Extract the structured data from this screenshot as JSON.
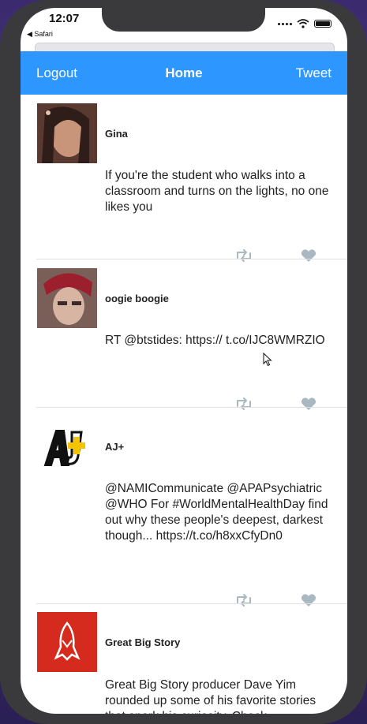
{
  "status_bar": {
    "time": "12:07",
    "back_label": "◀ Safari"
  },
  "nav": {
    "left_label": "Logout",
    "title": "Home",
    "right_label": "Tweet"
  },
  "tweets": [
    {
      "author": "Gina",
      "text": "If you're the student who walks into a classroom and turns on the lights, no one likes you"
    },
    {
      "author": "oogie boogie",
      "text": "RT @btstides: https:// t.co/IJC8WMRZIO"
    },
    {
      "author": "AJ+",
      "text": "@NAMICommunicate @APAPsychiatric @WHO For #WorldMentalHealthDay find out why these people's deepest, darkest though... https://t.co/h8xxCfyDn0"
    },
    {
      "author": "Great Big Story",
      "text": "Great Big Story producer Dave Yim rounded up some of his favorite stories that spark his curiosity. Check"
    }
  ],
  "colors": {
    "accent": "#2e97ff",
    "icon": "#aab8c2",
    "divider": "#e1e1e1"
  }
}
